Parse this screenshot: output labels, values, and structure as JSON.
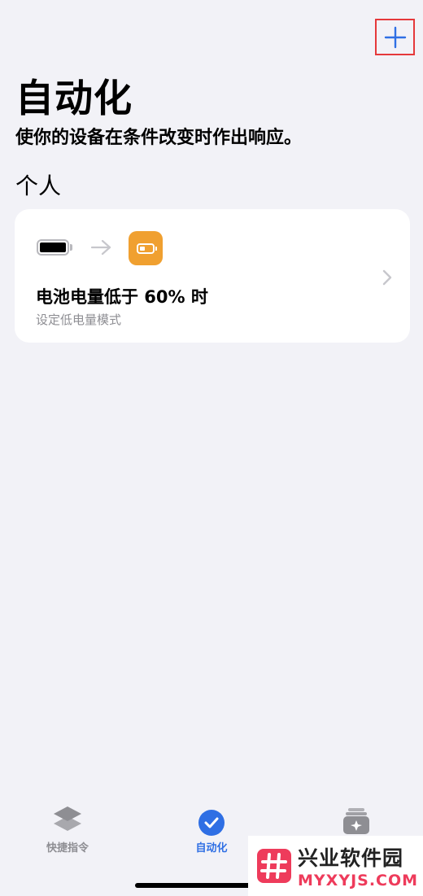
{
  "header": {
    "add_icon": "plus-icon",
    "title": "自动化",
    "subtitle": "使你的设备在条件改变时作出响应。"
  },
  "section": {
    "title": "个人"
  },
  "automation_card": {
    "trigger_icon": "battery-low-icon",
    "arrow_icon": "arrow-right-icon",
    "action_icon": "low-power-mode-icon",
    "title": "电池电量低于 60% 时",
    "description": "设定低电量模式",
    "chevron_icon": "chevron-right-icon"
  },
  "tabbar": {
    "tabs": [
      {
        "label": "快捷指令",
        "icon": "layers-icon",
        "active": false
      },
      {
        "label": "自动化",
        "icon": "checkmark-clock-icon",
        "active": true
      },
      {
        "label": "",
        "icon": "gallery-icon",
        "active": false
      }
    ],
    "active_color": "#2f6fe4",
    "inactive_color": "#8e8e93"
  },
  "watermark": {
    "title": "兴业软件园",
    "url": "MYXYJS.COM"
  },
  "colors": {
    "background": "#f2f2f7",
    "accent": "#2f6fe4",
    "action_icon_bg": "#f0a030"
  }
}
